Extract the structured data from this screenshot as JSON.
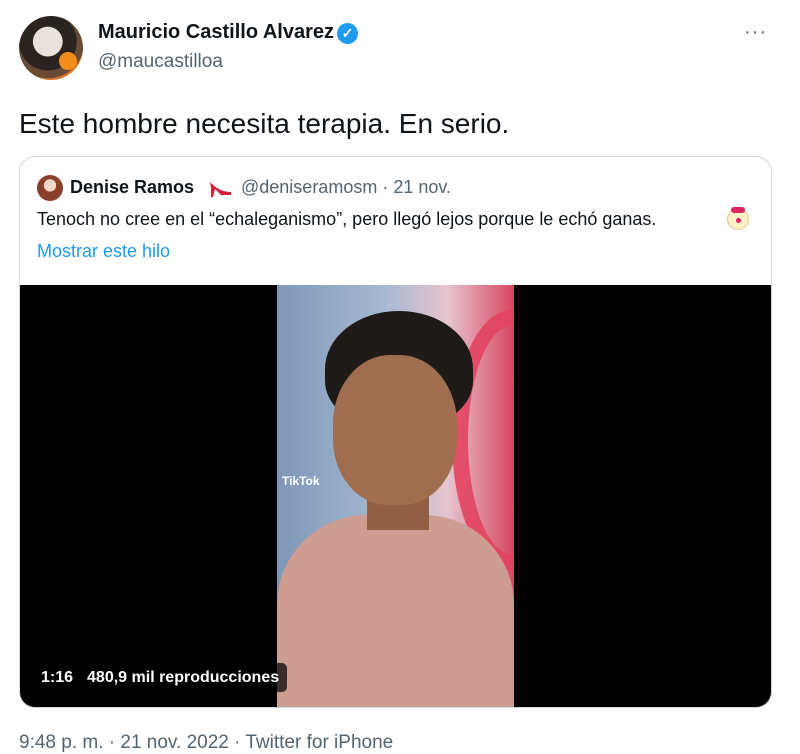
{
  "author": {
    "name": "Mauricio Castillo Alvarez",
    "handle": "@maucastilloa",
    "verified_mark": "✓",
    "avatar_icon": "avatar-icon"
  },
  "more_label": "···",
  "tweet_text": "Este hombre necesita terapia. En serio.",
  "quoted": {
    "name": "Denise Ramos",
    "name_emoji": "high-heel-icon",
    "meta": "@deniseramosm · 21 nov.",
    "text": "Tenoch no cree en el “echaleganismo”, pero llegó lejos porque le echó ganas.",
    "text_emoji": "clown-face-icon",
    "show_thread": "Mostrar este hilo"
  },
  "video": {
    "duration": "1:16",
    "views": "480,9 mil reproducciones",
    "watermark": "TikTok"
  },
  "footer": "9:48 p. m. · 21 nov. 2022 · Twitter for iPhone",
  "colors": {
    "accent": "#1d9bf0",
    "text": "#0f1419",
    "secondary": "#536471",
    "border": "#cfd9de"
  }
}
